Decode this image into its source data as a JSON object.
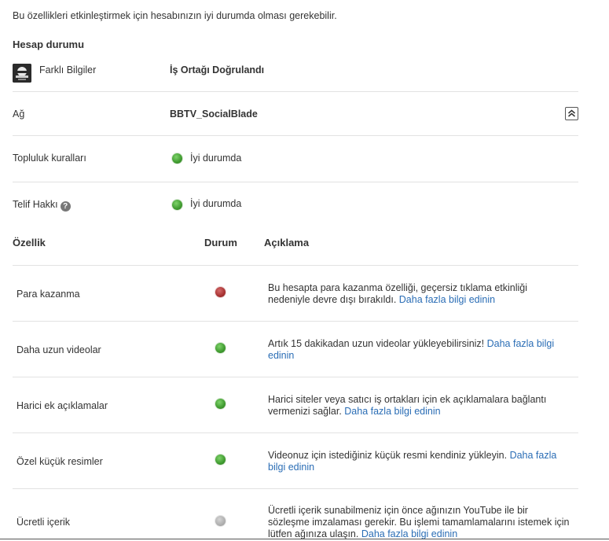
{
  "intro": "Bu özellikleri etkinleştirmek için hesabınızın iyi durumda olması gerekebilir.",
  "account_status": {
    "title": "Hesap durumu",
    "rows": [
      {
        "label": "Farklı Bilgiler",
        "value": "İş Ortağı Doğrulandı"
      },
      {
        "label": "Ağ",
        "value": "BBTV_SocialBlade"
      },
      {
        "label": "Topluluk kuralları",
        "value": "İyi durumda",
        "status": "green"
      },
      {
        "label": "Telif Hakkı",
        "value": "İyi durumda",
        "status": "green"
      }
    ]
  },
  "features": {
    "headers": {
      "feature": "Özellik",
      "status": "Durum",
      "description": "Açıklama"
    },
    "link_text": "Daha fazla bilgi edinin",
    "rows": [
      {
        "name": "Para kazanma",
        "status": "red",
        "desc": "Bu hesapta para kazanma özelliği, geçersiz tıklama etkinliği nedeniyle devre dışı bırakıldı."
      },
      {
        "name": "Daha uzun videolar",
        "status": "green",
        "desc": "Artık 15 dakikadan uzun videolar yükleyebilirsiniz!"
      },
      {
        "name": "Harici ek açıklamalar",
        "status": "green",
        "desc": "Harici siteler veya satıcı iş ortakları için ek açıklamalara bağlantı vermenizi sağlar."
      },
      {
        "name": "Özel küçük resimler",
        "status": "green",
        "desc": "Videonuz için istediğiniz küçük resmi kendiniz yükleyin."
      },
      {
        "name": "Ücretli içerik",
        "status": "gray",
        "desc": "Ücretli içerik sunabilmeniz için önce ağınızın YouTube ile bir sözleşme imzalaması gerekir. Bu işlemi tamamlamalarını istemek için lütfen ağınıza ulaşın."
      }
    ]
  },
  "colors": {
    "status_green": "#3f9a2f",
    "status_red": "#a83232",
    "status_gray": "#a9a9a9",
    "link": "#2a6db5"
  }
}
